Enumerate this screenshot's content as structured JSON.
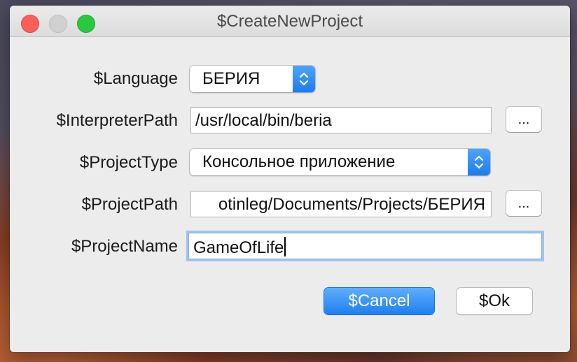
{
  "window": {
    "title": "$CreateNewProject"
  },
  "form": {
    "language": {
      "label": "$Language",
      "value": "БЕРИЯ"
    },
    "interpreter_path": {
      "label": "$InterpreterPath",
      "value": "/usr/local/bin/beria",
      "browse_label": "..."
    },
    "project_type": {
      "label": "$ProjectType",
      "value": "Консольное приложение"
    },
    "project_path": {
      "label": "$ProjectPath",
      "value": "otinleg/Documents/Projects/БЕРИЯ",
      "browse_label": "..."
    },
    "project_name": {
      "label": "$ProjectName",
      "value": "GameOfLife"
    }
  },
  "buttons": {
    "cancel": "$Cancel",
    "ok": "$Ok"
  },
  "colors": {
    "accent": "#1e7ff0",
    "close": "#fc5f57",
    "maximize": "#2ac840"
  }
}
